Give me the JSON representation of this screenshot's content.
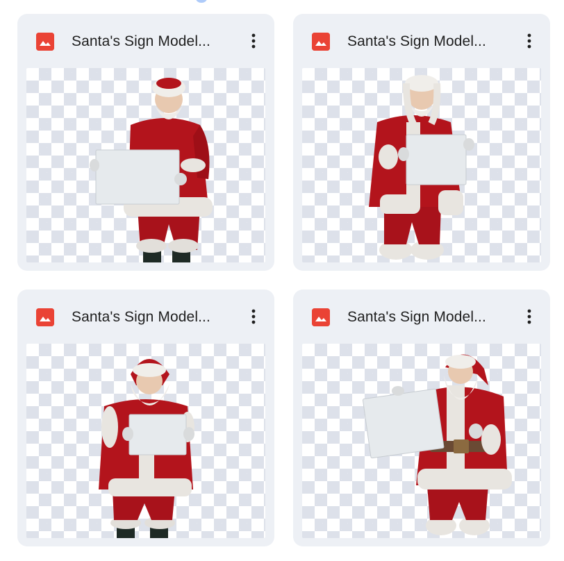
{
  "files": [
    {
      "title": "Santa's Sign Model...",
      "file_type_icon": "image-file-icon",
      "menu_icon": "more-vert-icon"
    },
    {
      "title": "Santa's Sign Model...",
      "file_type_icon": "image-file-icon",
      "menu_icon": "more-vert-icon"
    },
    {
      "title": "Santa's Sign Model...",
      "file_type_icon": "image-file-icon",
      "menu_icon": "more-vert-icon"
    },
    {
      "title": "Santa's Sign Model...",
      "file_type_icon": "image-file-icon",
      "menu_icon": "more-vert-icon"
    }
  ],
  "colors": {
    "card_background": "#edf0f5",
    "image_icon": "#ea4335",
    "title_text": "#1f1f1f",
    "checker_dark": "#dde1ea",
    "santa_red": "#b3141c",
    "fur_white": "#eceae6",
    "sign_white": "#e6eaed"
  }
}
